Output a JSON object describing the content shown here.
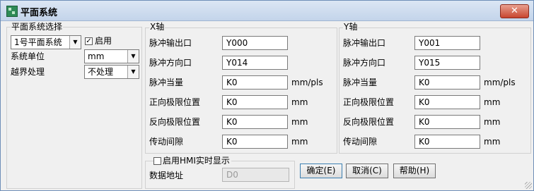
{
  "title": "平面系统",
  "close_symbol": "✕",
  "left": {
    "group_title": "平面系统选择",
    "plane_select": "1号平面系统",
    "enable_label": "启用",
    "enable_checked": true,
    "unit_label": "系统单位",
    "unit_value": "mm",
    "limit_label": "越界处理",
    "limit_value": "不处理"
  },
  "x_axis": {
    "title": "X轴",
    "rows": [
      {
        "label": "脉冲输出口",
        "value": "Y000",
        "unit": ""
      },
      {
        "label": "脉冲方向口",
        "value": "Y014",
        "unit": ""
      },
      {
        "label": "脉冲当量",
        "value": "K0",
        "unit": "mm/pls"
      },
      {
        "label": "正向极限位置",
        "value": "K0",
        "unit": "mm"
      },
      {
        "label": "反向极限位置",
        "value": "K0",
        "unit": "mm"
      },
      {
        "label": "传动间隙",
        "value": "K0",
        "unit": "mm"
      }
    ]
  },
  "y_axis": {
    "title": "Y轴",
    "rows": [
      {
        "label": "脉冲输出口",
        "value": "Y001",
        "unit": ""
      },
      {
        "label": "脉冲方向口",
        "value": "Y015",
        "unit": ""
      },
      {
        "label": "脉冲当量",
        "value": "K0",
        "unit": "mm/pls"
      },
      {
        "label": "正向极限位置",
        "value": "K0",
        "unit": "mm"
      },
      {
        "label": "反向极限位置",
        "value": "K0",
        "unit": "mm"
      },
      {
        "label": "传动间隙",
        "value": "K0",
        "unit": "mm"
      }
    ]
  },
  "hmi": {
    "checkbox_label": "启用HMI实时显示",
    "checked": false,
    "address_label": "数据地址",
    "address_value": "D0"
  },
  "buttons": {
    "ok": "确定(E)",
    "cancel": "取消(C)",
    "help": "帮助(H)"
  }
}
